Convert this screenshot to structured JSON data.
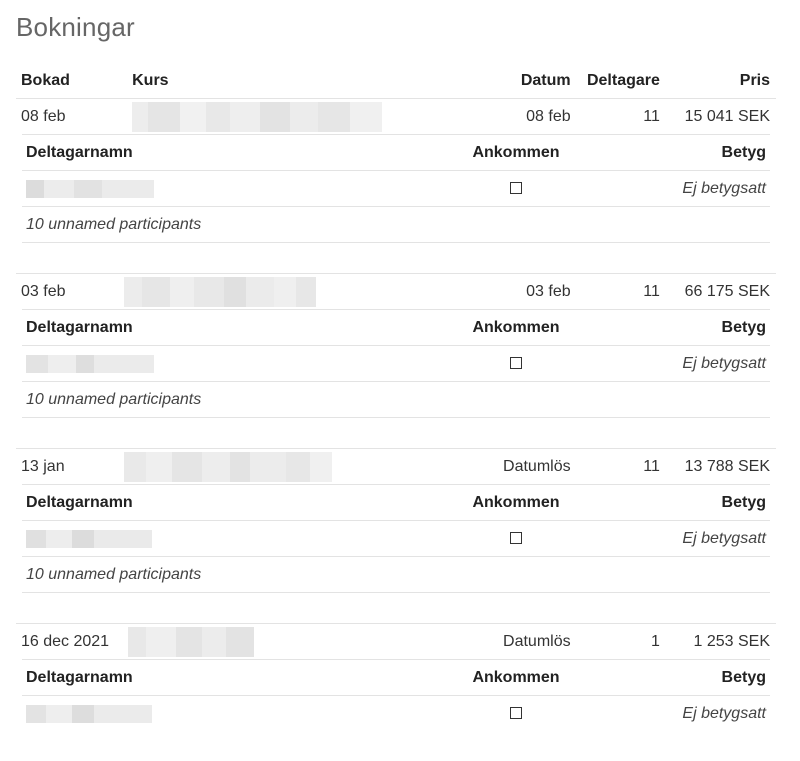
{
  "page_title": "Bokningar",
  "table_headers": {
    "bokad": "Bokad",
    "kurs": "Kurs",
    "datum": "Datum",
    "deltagare": "Deltagare",
    "pris": "Pris"
  },
  "participants_headers": {
    "name": "Deltagarnamn",
    "arrived": "Ankommen",
    "grade": "Betyg"
  },
  "bookings": [
    {
      "booked": "08 feb",
      "date": "08 feb",
      "participants": "11",
      "price": "15 041 SEK",
      "grade_text": "Ej betygsatt",
      "unnamed_text": "10 unnamed participants"
    },
    {
      "booked": "03 feb",
      "date": "03 feb",
      "participants": "11",
      "price": "66 175 SEK",
      "grade_text": "Ej betygsatt",
      "unnamed_text": "10 unnamed participants"
    },
    {
      "booked": "13 jan",
      "date": "Datumlös",
      "participants": "11",
      "price": "13 788 SEK",
      "grade_text": "Ej betygsatt",
      "unnamed_text": "10 unnamed participants"
    },
    {
      "booked": "16 dec 2021",
      "date": "Datumlös",
      "participants": "1",
      "price": "1 253 SEK",
      "grade_text": "Ej betygsatt",
      "unnamed_text": ""
    }
  ]
}
